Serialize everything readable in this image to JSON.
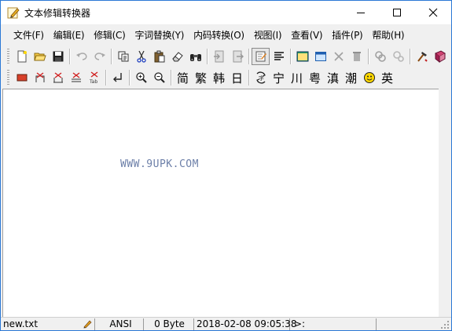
{
  "window": {
    "title": "文本修辑转换器"
  },
  "menu": [
    "文件(F)",
    "编辑(E)",
    "修辑(C)",
    "字词替换(Y)",
    "内码转换(O)",
    "视图(I)",
    "查看(V)",
    "插件(P)",
    "帮助(H)"
  ],
  "toolbar2": {
    "chars": [
      "简",
      "繁",
      "韩",
      "日",
      "宁",
      "川",
      "粤",
      "滇",
      "潮",
      "英"
    ]
  },
  "editor": {
    "watermark": "WWW.9UPK.COM"
  },
  "status": {
    "filename": "new.txt",
    "encoding": "ANSI",
    "size": "0 Byte",
    "datetime": "2018-02-08 09:05:38",
    "cursor": ">:"
  },
  "colors": {
    "titlebar": "#ffffff",
    "border": "#2b78d6",
    "chrome": "#f0f0f0"
  }
}
